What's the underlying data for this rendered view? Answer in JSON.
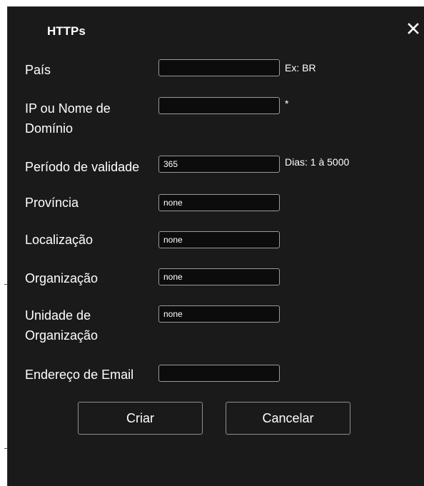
{
  "dialog": {
    "title": "HTTPs",
    "close_icon": "close-icon"
  },
  "form": {
    "country": {
      "label": "País",
      "value": "",
      "hint": "Ex: BR"
    },
    "domain": {
      "label_line1": "IP ou Nome de",
      "label_line2": "Domínio",
      "value": "",
      "hint": "*"
    },
    "validity": {
      "label": "Período de validade",
      "value": "365",
      "hint": "Dias: 1 à 5000"
    },
    "province": {
      "label": "Província",
      "value": "none"
    },
    "location": {
      "label": "Localização",
      "value": "none"
    },
    "organization": {
      "label": "Organização",
      "value": "none"
    },
    "org_unit": {
      "label_line1": "Unidade de",
      "label_line2": "Organização",
      "value": "none"
    },
    "email": {
      "label": "Endereço de Email",
      "value": ""
    }
  },
  "buttons": {
    "create": "Criar",
    "cancel": "Cancelar"
  }
}
